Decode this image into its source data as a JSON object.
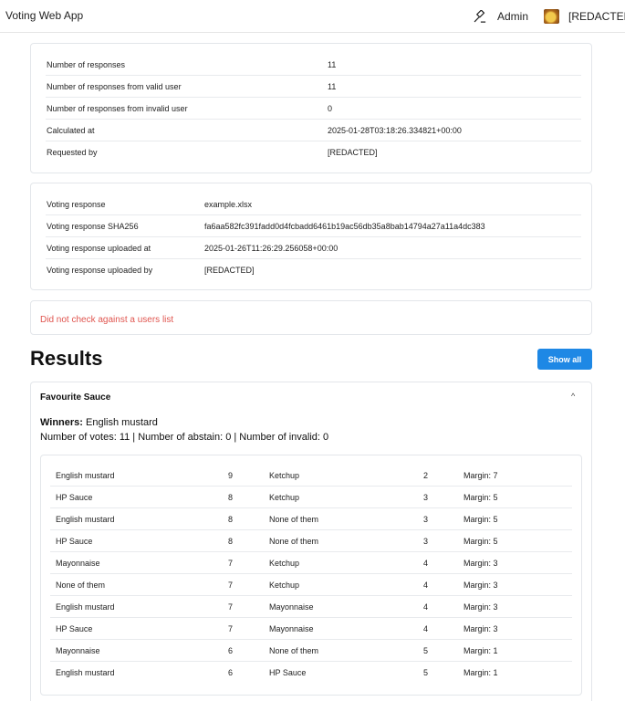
{
  "navbar": {
    "brand": "Voting Web App",
    "admin_label": "Admin",
    "admin_icon": "gavel-icon",
    "user_label": "[REDACTED]"
  },
  "stats": [
    {
      "key": "Number of responses",
      "value": "11"
    },
    {
      "key": "Number of responses from valid user",
      "value": "11"
    },
    {
      "key": "Number of responses from invalid user",
      "value": "0"
    },
    {
      "key": "Calculated at",
      "value": "2025-01-28T03:18:26.334821+00:00"
    },
    {
      "key": "Requested by",
      "value": "[REDACTED]"
    }
  ],
  "response_info": [
    {
      "key": "Voting response",
      "value": "example.xlsx"
    },
    {
      "key": "Voting response SHA256",
      "value": "fa6aa582fc391fadd0d4fcbadd6461b19ac56db35a8bab14794a27a11a4dc383"
    },
    {
      "key": "Voting response uploaded at",
      "value": "2025-01-26T11:26:29.256058+00:00"
    },
    {
      "key": "Voting response uploaded by",
      "value": "[REDACTED]"
    }
  ],
  "warning": "Did not check against a users list",
  "results": {
    "title": "Results",
    "show_all_label": "Show all",
    "question": {
      "title": "Favourite Sauce",
      "caret": "^",
      "winners_label": "Winners:",
      "winners": "English mustard",
      "summary": "Number of votes: 11 | Number of abstain: 0 | Number of invalid: 0",
      "pairs": [
        {
          "a": "English mustard",
          "a_votes": "9",
          "b": "Ketchup",
          "b_votes": "2",
          "margin": "Margin: 7"
        },
        {
          "a": "HP Sauce",
          "a_votes": "8",
          "b": "Ketchup",
          "b_votes": "3",
          "margin": "Margin: 5"
        },
        {
          "a": "English mustard",
          "a_votes": "8",
          "b": "None of them",
          "b_votes": "3",
          "margin": "Margin: 5"
        },
        {
          "a": "HP Sauce",
          "a_votes": "8",
          "b": "None of them",
          "b_votes": "3",
          "margin": "Margin: 5"
        },
        {
          "a": "Mayonnaise",
          "a_votes": "7",
          "b": "Ketchup",
          "b_votes": "4",
          "margin": "Margin: 3"
        },
        {
          "a": "None of them",
          "a_votes": "7",
          "b": "Ketchup",
          "b_votes": "4",
          "margin": "Margin: 3"
        },
        {
          "a": "English mustard",
          "a_votes": "7",
          "b": "Mayonnaise",
          "b_votes": "4",
          "margin": "Margin: 3"
        },
        {
          "a": "HP Sauce",
          "a_votes": "7",
          "b": "Mayonnaise",
          "b_votes": "4",
          "margin": "Margin: 3"
        },
        {
          "a": "Mayonnaise",
          "a_votes": "6",
          "b": "None of them",
          "b_votes": "5",
          "margin": "Margin: 1"
        },
        {
          "a": "English mustard",
          "a_votes": "6",
          "b": "HP Sauce",
          "b_votes": "5",
          "margin": "Margin: 1"
        }
      ]
    }
  }
}
